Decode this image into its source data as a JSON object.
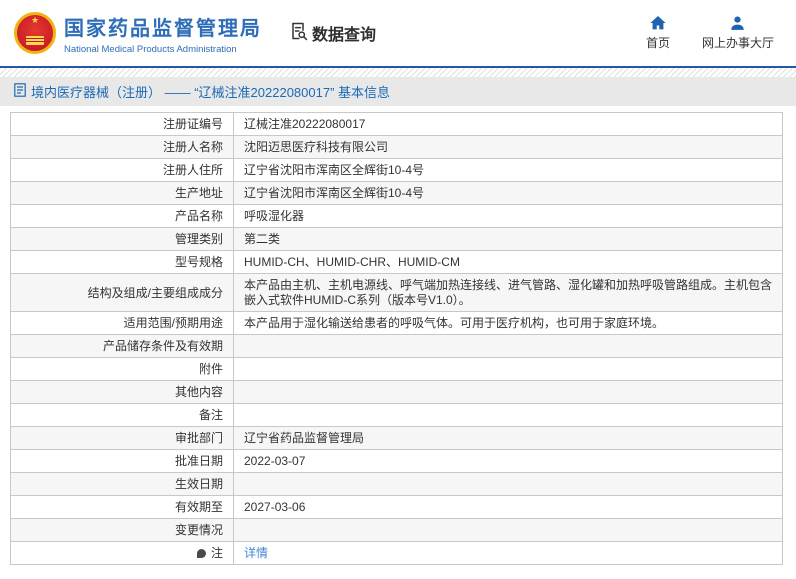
{
  "header": {
    "org_name_cn": "国家药品监督管理局",
    "org_name_en": "National Medical Products Administration",
    "section_title": "数据查询",
    "nav": [
      {
        "label": "首页",
        "icon": "home-icon"
      },
      {
        "label": "网上办事大厅",
        "icon": "person-icon"
      }
    ]
  },
  "breadcrumb": {
    "icon": "document-icon",
    "text": "境内医疗器械（注册） —— “辽械注准20222080017” 基本信息"
  },
  "table": {
    "rows": [
      {
        "label": "注册证编号",
        "value": "辽械注准20222080017"
      },
      {
        "label": "注册人名称",
        "value": "沈阳迈思医疗科技有限公司"
      },
      {
        "label": "注册人住所",
        "value": "辽宁省沈阳市浑南区全辉街10-4号"
      },
      {
        "label": "生产地址",
        "value": "辽宁省沈阳市浑南区全辉街10-4号"
      },
      {
        "label": "产品名称",
        "value": "呼吸湿化器"
      },
      {
        "label": "管理类别",
        "value": "第二类"
      },
      {
        "label": "型号规格",
        "value": "HUMID-CH、HUMID-CHR、HUMID-CM"
      },
      {
        "label": "结构及组成/主要组成成分",
        "value": "本产品由主机、主机电源线、呼气端加热连接线、进气管路、湿化罐和加热呼吸管路组成。主机包含嵌入式软件HUMID-C系列（版本号V1.0）。"
      },
      {
        "label": "适用范围/预期用途",
        "value": "本产品用于湿化输送给患者的呼吸气体。可用于医疗机构，也可用于家庭环境。"
      },
      {
        "label": "产品储存条件及有效期",
        "value": ""
      },
      {
        "label": "附件",
        "value": ""
      },
      {
        "label": "其他内容",
        "value": ""
      },
      {
        "label": "备注",
        "value": ""
      },
      {
        "label": "审批部门",
        "value": "辽宁省药品监督管理局"
      },
      {
        "label": "批准日期",
        "value": "2022-03-07"
      },
      {
        "label": "生效日期",
        "value": ""
      },
      {
        "label": "有效期至",
        "value": "2027-03-06"
      },
      {
        "label": "变更情况",
        "value": ""
      },
      {
        "label": "注",
        "label_icon": "note-icon",
        "value": "详情",
        "link": true
      }
    ]
  },
  "colors": {
    "brand_blue": "#2e6db8",
    "nav_icon_blue": "#1f62b0",
    "divider_blue": "#2257a5",
    "breadcrumb_text": "#1b6ab5",
    "link_blue": "#4285d3",
    "emblem_red": "#d0202a",
    "emblem_gold": "#efb312",
    "row_stripe": "#f6f6f7",
    "table_border": "#c8c8c8"
  }
}
